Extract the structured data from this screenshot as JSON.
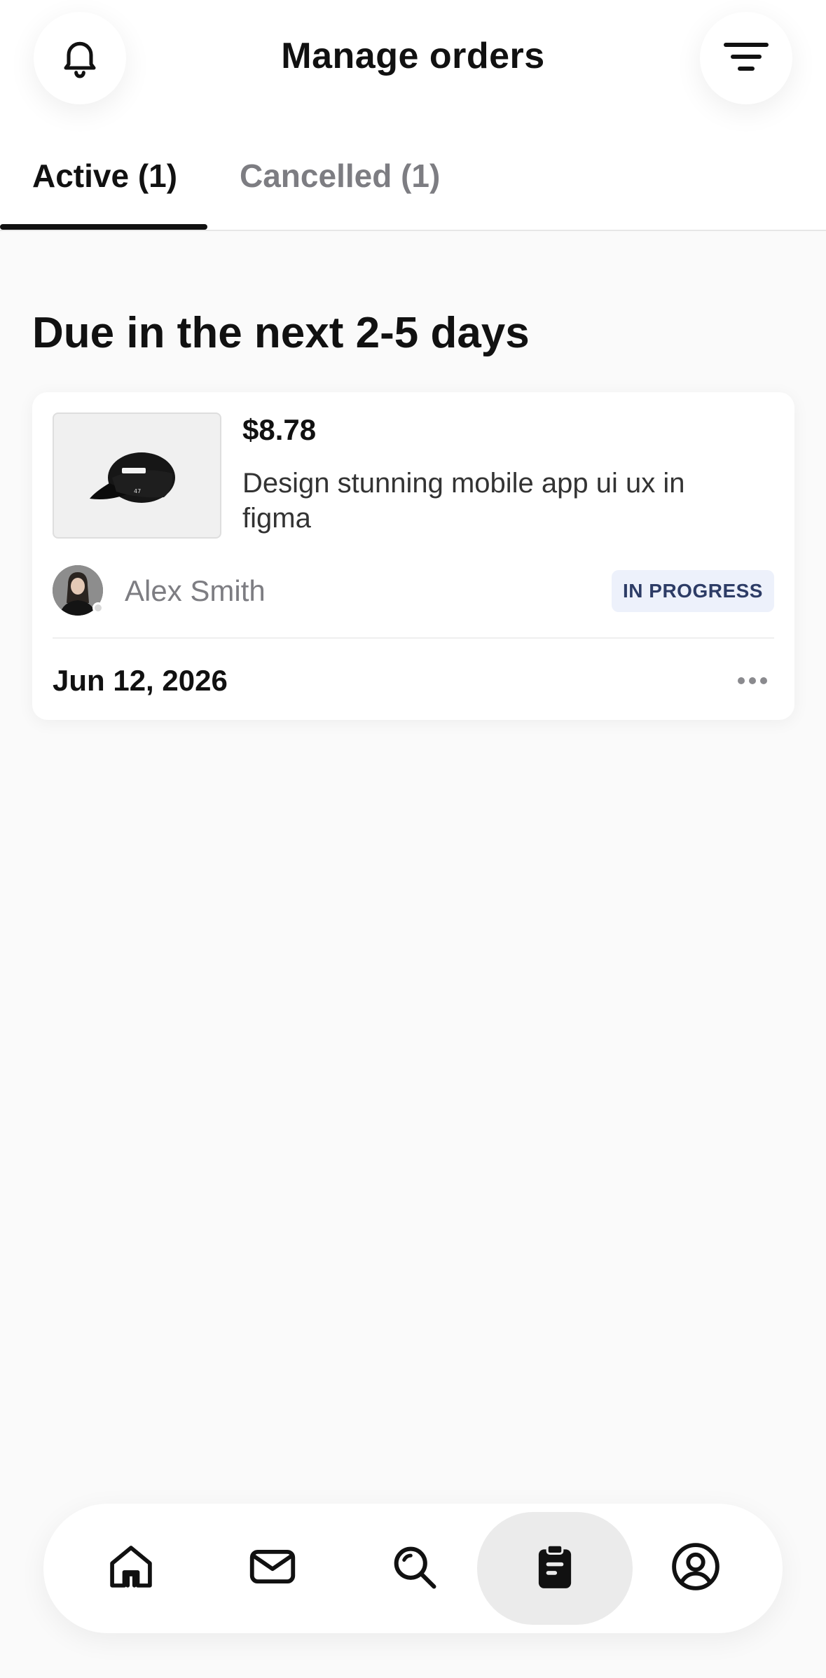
{
  "header": {
    "title": "Manage orders",
    "left_icon": "bell-icon",
    "right_icon": "filter-icon"
  },
  "tabs": [
    {
      "label": "Active (1)",
      "active": true
    },
    {
      "label": "Cancelled (1)",
      "active": false
    }
  ],
  "section": {
    "title": "Due in the next 2-5 days"
  },
  "order": {
    "price": "$8.78",
    "description": "Design stunning mobile app ui ux in figma",
    "thumbnail_icon": "cap-product-image",
    "seller_name": "Alex Smith",
    "status": "IN PROGRESS",
    "due_date": "Jun 12, 2026",
    "more_icon": "ellipsis-icon"
  },
  "bottom_nav": [
    {
      "name": "home",
      "icon": "home-icon",
      "active": false
    },
    {
      "name": "inbox",
      "icon": "mail-icon",
      "active": false
    },
    {
      "name": "search",
      "icon": "search-icon",
      "active": false
    },
    {
      "name": "orders",
      "icon": "clipboard-icon",
      "active": true
    },
    {
      "name": "profile",
      "icon": "user-icon",
      "active": false
    }
  ],
  "colors": {
    "background": "#fafafa",
    "text_primary": "#111111",
    "text_muted": "#7d7d82",
    "badge_bg": "#edf1fb",
    "badge_text": "#2d3c66",
    "nav_active_bg": "#ebebeb"
  }
}
